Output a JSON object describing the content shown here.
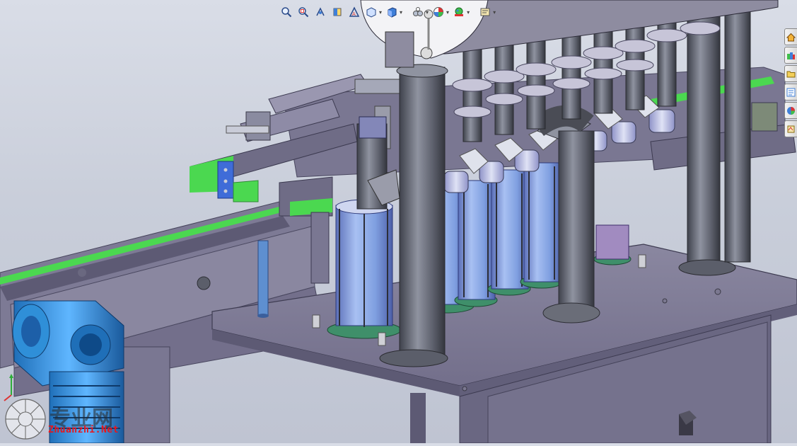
{
  "app": {
    "name": "CAD 3D model viewport"
  },
  "toolbar": {
    "items": [
      {
        "icon": "zoom-to-fit-icon",
        "tooltip": ""
      },
      {
        "icon": "zoom-to-area-icon",
        "tooltip": ""
      },
      {
        "icon": "previous-view-icon",
        "tooltip": ""
      },
      {
        "icon": "section-view-icon",
        "tooltip": ""
      },
      {
        "icon": "dynamic-annotation-icon",
        "tooltip": ""
      },
      {
        "icon": "view-orientation-icon",
        "tooltip": ""
      },
      {
        "icon": "display-style-icon",
        "tooltip": ""
      },
      {
        "icon": "hide-show-items-icon",
        "tooltip": ""
      },
      {
        "icon": "edit-appearance-icon",
        "tooltip": ""
      },
      {
        "icon": "apply-scene-icon",
        "tooltip": ""
      },
      {
        "icon": "view-settings-icon",
        "tooltip": ""
      }
    ]
  },
  "task_pane": {
    "tabs": [
      {
        "icon": "home-resources-icon"
      },
      {
        "icon": "design-library-icon"
      },
      {
        "icon": "file-explorer-icon"
      },
      {
        "icon": "view-palette-icon"
      },
      {
        "icon": "appearances-scenes-icon"
      },
      {
        "icon": "custom-properties-icon"
      }
    ]
  },
  "watermark": {
    "text": "Zhuanzhi.Net",
    "chinese": "专业网"
  },
  "colors": {
    "frame": "#6f6c86",
    "frame_light": "#8b88a3",
    "rail_green": "#4bd850",
    "cylinder_blue": "#7f9fe0",
    "motor_blue": "#2f8fd8",
    "flange_green": "#3f8f6a",
    "pipe_dark": "#5b5e6a",
    "background": "#c9ceda"
  }
}
